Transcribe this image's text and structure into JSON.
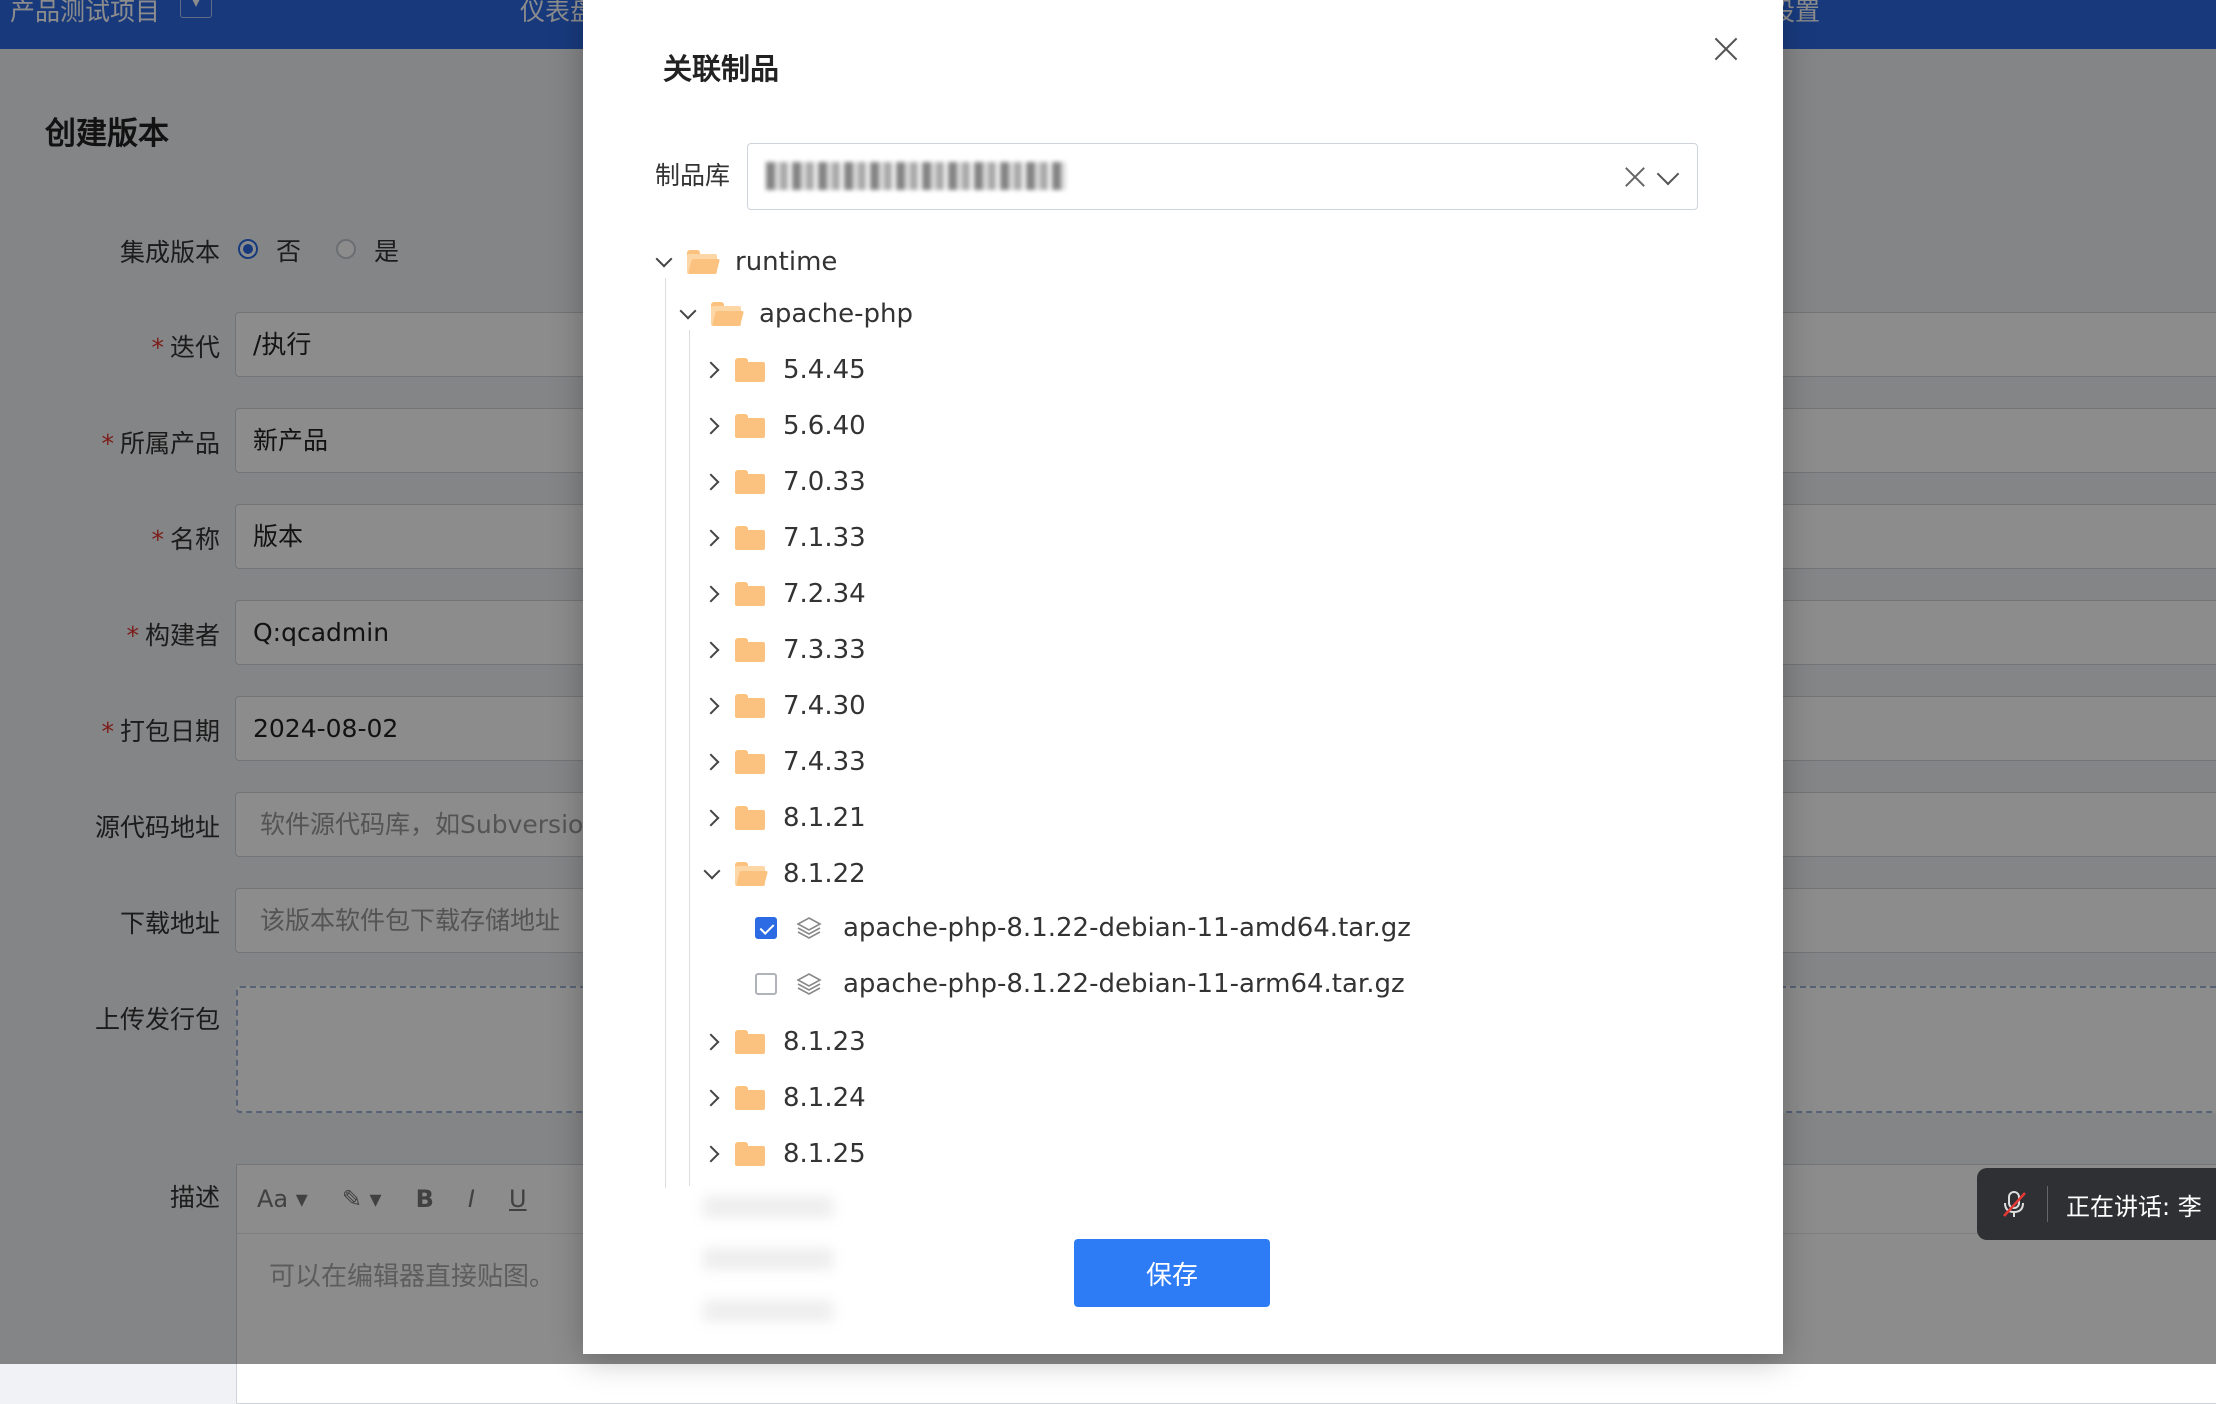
{
  "topbar": {
    "project": "产品测试项目",
    "menu_dashboard": "仪表盘",
    "menu_settings": "设置"
  },
  "page": {
    "title": "创建版本",
    "integrated_label": "集成版本",
    "radio_no": "否",
    "radio_yes": "是",
    "iteration_label": "迭代",
    "iteration_value": "/执行",
    "product_label": "所属产品",
    "product_value": "新产品",
    "name_label": "名称",
    "name_value": "版本",
    "builder_label": "构建者",
    "builder_value": "Q:qcadmin",
    "date_label": "打包日期",
    "date_value": "2024-08-02",
    "source_label": "源代码地址",
    "source_placeholder": "软件源代码库，如Subversion",
    "download_label": "下载地址",
    "download_placeholder": "该版本软件包下载存储地址",
    "upload_label": "上传发行包",
    "desc_label": "描述",
    "editor_placeholder": "可以在编辑器直接贴图。"
  },
  "modal": {
    "title": "关联制品",
    "library_label": "制品库",
    "save_label": "保存",
    "tree": {
      "root": "runtime",
      "child": "apache-php",
      "versions": [
        "5.4.45",
        "5.6.40",
        "7.0.33",
        "7.1.33",
        "7.2.34",
        "7.3.33",
        "7.4.30",
        "7.4.33",
        "8.1.21",
        "8.1.22",
        "8.1.23",
        "8.1.24",
        "8.1.25"
      ],
      "expanded_version": "8.1.22",
      "files": [
        {
          "name": "apache-php-8.1.22-debian-11-amd64.tar.gz",
          "checked": true
        },
        {
          "name": "apache-php-8.1.22-debian-11-arm64.tar.gz",
          "checked": false
        }
      ]
    }
  },
  "toast": {
    "text": "正在讲话: 李"
  },
  "colors": {
    "primary": "#2d6be4",
    "button": "#2d7cf6",
    "folder": "#fbc17e"
  }
}
